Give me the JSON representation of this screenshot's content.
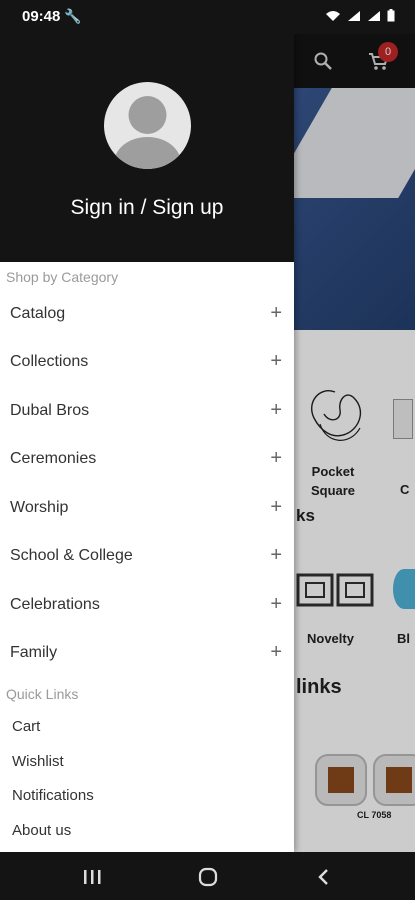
{
  "status_bar": {
    "time": "09:48"
  },
  "background": {
    "cart_count": "0",
    "categories": [
      "Pocket Square",
      "C"
    ],
    "section_1_partial": "ks",
    "products": [
      "Novelty",
      "Bl"
    ],
    "section_2_partial": "links",
    "product_code": "CL 7058"
  },
  "drawer": {
    "sign_in_label": "Sign in / Sign up",
    "shop_by_category_label": "Shop by Category",
    "categories": [
      {
        "label": "Catalog"
      },
      {
        "label": "Collections"
      },
      {
        "label": "Dubal Bros"
      },
      {
        "label": "Ceremonies"
      },
      {
        "label": "Worship"
      },
      {
        "label": "School & College"
      },
      {
        "label": "Celebrations"
      },
      {
        "label": "Family"
      }
    ],
    "expand_symbol": "+",
    "quick_links_label": "Quick Links",
    "quick_links": [
      {
        "label": "Cart"
      },
      {
        "label": "Wishlist"
      },
      {
        "label": "Notifications"
      },
      {
        "label": "About us"
      }
    ]
  }
}
